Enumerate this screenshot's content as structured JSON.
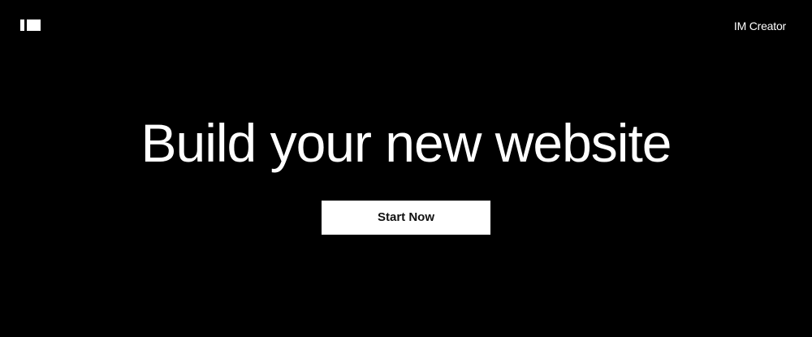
{
  "header": {
    "logo_icon": "imcreator-logo-icon",
    "brand_label": "IM Creator"
  },
  "hero": {
    "headline": "Build your new website",
    "cta_label": "Start Now"
  },
  "colors": {
    "background": "#000000",
    "text": "#ffffff",
    "button_bg": "#ffffff",
    "button_text": "#111111"
  }
}
